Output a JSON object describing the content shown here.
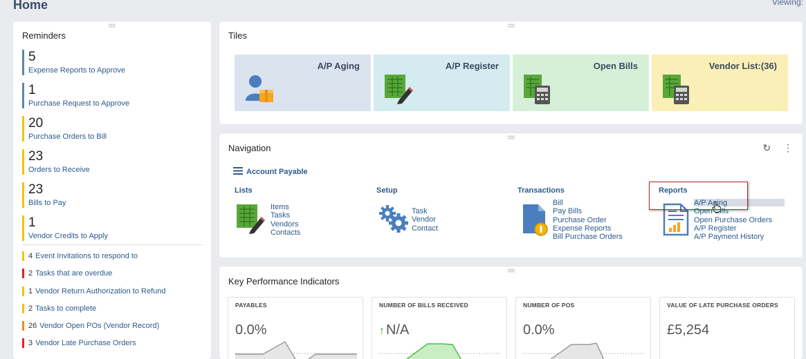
{
  "page": {
    "title": "Home",
    "viewing_label": "Viewing:"
  },
  "reminders": {
    "title": "Reminders",
    "primary": [
      {
        "count": "5",
        "label": "Expense Reports to Approve"
      },
      {
        "count": "1",
        "label": "Purchase Request to Approve"
      },
      {
        "count": "20",
        "label": "Purchase Orders to Bill"
      },
      {
        "count": "23",
        "label": "Orders to Receive"
      },
      {
        "count": "23",
        "label": "Bills to Pay"
      },
      {
        "count": "1",
        "label": "Vendor Credits to Apply"
      }
    ],
    "secondary": [
      {
        "count": "4",
        "label": "Event Invitations to respond to"
      },
      {
        "count": "2",
        "label": "Tasks that are overdue"
      },
      {
        "count": "1",
        "label": "Vendor Return Authorization to Refund"
      },
      {
        "count": "2",
        "label": "Tasks to complete"
      },
      {
        "count": "26",
        "label": "Vendor Open POs (Vendor Record)"
      },
      {
        "count": "3",
        "label": "Vendor Late Purchase Orders"
      }
    ]
  },
  "tiles": {
    "title": "Tiles",
    "items": [
      {
        "label": "A/P Aging",
        "color": "#dbe3ef"
      },
      {
        "label": "A/P Register",
        "color": "#d4ecef"
      },
      {
        "label": "Open Bills",
        "color": "#d6f0d8"
      },
      {
        "label": "Vendor List:(36)",
        "color": "#faefb6"
      }
    ]
  },
  "navigation": {
    "title": "Navigation",
    "section": "Account Payable",
    "refresh_icon": "↻",
    "more_icon": "⋮",
    "columns": {
      "lists": {
        "title": "Lists",
        "links": [
          "Items",
          "Tasks",
          "Vendors",
          "Contacts"
        ]
      },
      "setup": {
        "title": "Setup",
        "links": [
          "Task",
          "Vendor",
          "Contact"
        ]
      },
      "transactions": {
        "title": "Transactions",
        "links": [
          "Bill",
          "Pay Bills",
          "Purchase Order",
          "Expense Reports",
          "Bill Purchase Orders"
        ]
      },
      "reports": {
        "title": "Reports",
        "links": [
          "A/P Aging",
          "Open Bills",
          "Open Purchase Orders",
          "A/P Register",
          "A/P Payment History"
        ]
      }
    }
  },
  "kpi": {
    "title": "Key Performance Indicators",
    "cards": [
      {
        "title": "PAYABLES",
        "value": "0.0%"
      },
      {
        "title": "NUMBER OF BILLS RECEIVED",
        "value": "N/A",
        "trend": "↑"
      },
      {
        "title": "NUMBER OF POS",
        "value": "0.0%"
      },
      {
        "title": "VALUE OF LATE PURCHASE ORDERS",
        "value": "£5,254"
      }
    ]
  }
}
